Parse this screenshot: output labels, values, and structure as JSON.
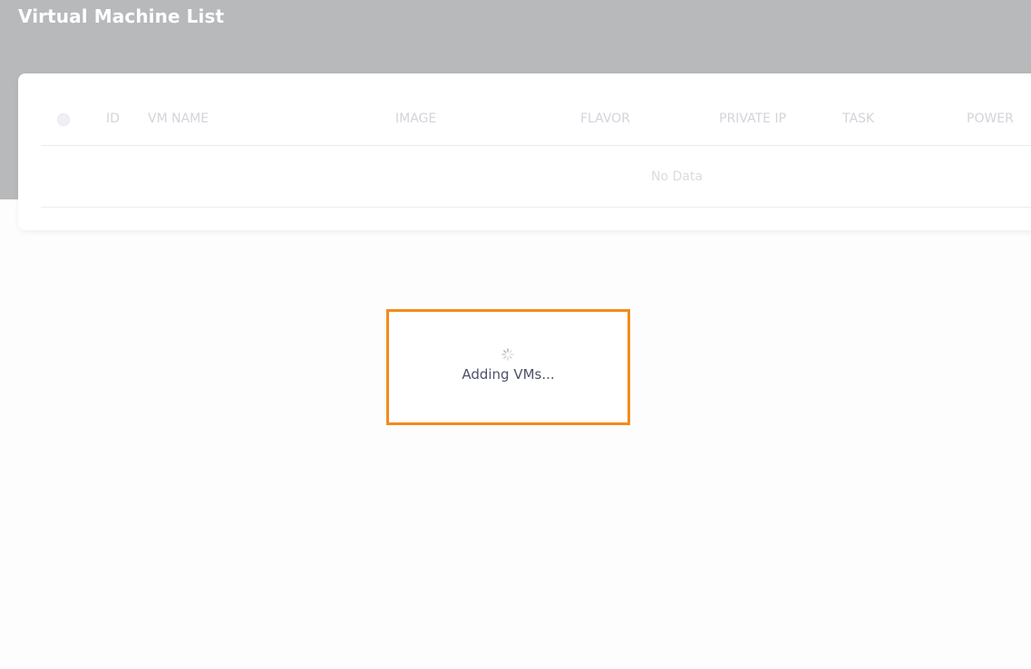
{
  "page": {
    "title": "Virtual Machine List",
    "header_color": "#b8b9bb"
  },
  "table": {
    "columns": [
      "ID",
      "VM NAME",
      "IMAGE",
      "FLAVOR",
      "PRIVATE IP",
      "TASK",
      "POWER"
    ],
    "rows": [],
    "empty_text": "No Data"
  },
  "loader": {
    "text": "Adding VMs...",
    "icon": "spinner-icon",
    "border_color": "#f28c1c"
  }
}
